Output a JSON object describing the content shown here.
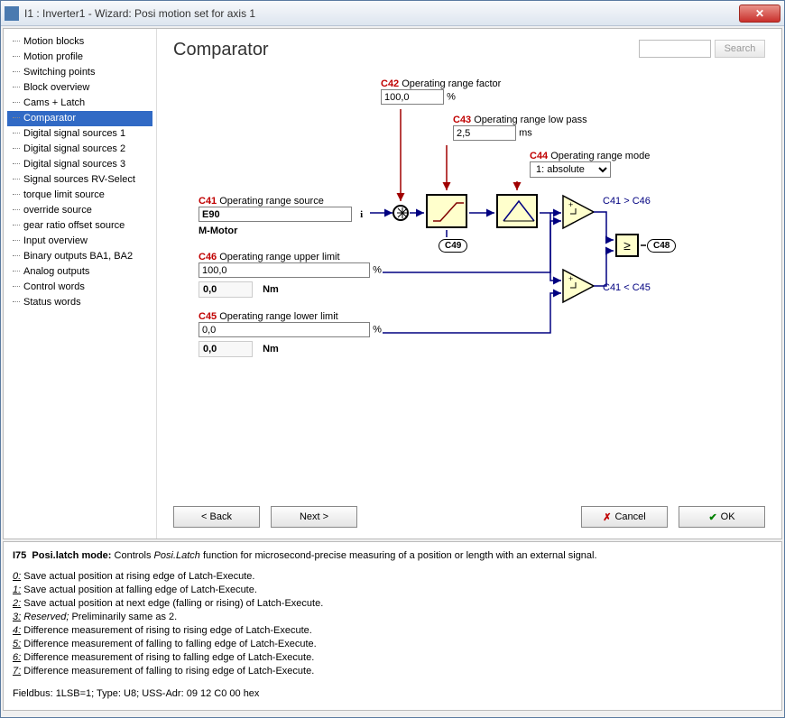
{
  "window": {
    "title": "I1 : Inverter1 - Wizard: Posi motion set for axis 1"
  },
  "sidebar": {
    "items": [
      "Motion blocks",
      "Motion profile",
      "Switching points",
      "Block overview",
      "Cams + Latch",
      "Comparator",
      "Digital signal sources 1",
      "Digital signal sources 2",
      "Digital signal sources 3",
      "Signal sources RV-Select",
      "torque limit source",
      "override source",
      "gear ratio offset source",
      "Input overview",
      "Binary outputs BA1, BA2",
      "Analog outputs",
      "Control words",
      "Status words"
    ],
    "selected_index": 5
  },
  "page": {
    "title": "Comparator",
    "search_placeholder": "",
    "search_btn": "Search"
  },
  "params": {
    "c42": {
      "code": "C42",
      "label": "Operating range factor",
      "value": "100,0",
      "unit": "%"
    },
    "c43": {
      "code": "C43",
      "label": "Operating range low pass",
      "value": "2,5",
      "unit": "ms"
    },
    "c44": {
      "code": "C44",
      "label": "Operating range mode",
      "value": "1: absolute"
    },
    "c41": {
      "code": "C41",
      "label": "Operating range source",
      "value": "E90",
      "info": "i",
      "sub": "M-Motor"
    },
    "c46": {
      "code": "C46",
      "label": "Operating range upper limit",
      "value": "100,0",
      "unit": "%",
      "readout": "0,0",
      "readout_unit": "Nm"
    },
    "c45": {
      "code": "C45",
      "label": "Operating range lower limit",
      "value": "0,0",
      "unit": "%",
      "readout": "0,0",
      "readout_unit": "Nm"
    }
  },
  "blocks": {
    "c49": "C49",
    "c48": "C48",
    "cmp_upper": "C41 > C46",
    "cmp_lower": "C41 < C45",
    "ge": "≥"
  },
  "nav": {
    "back": "< Back",
    "next": "Next >",
    "cancel": "Cancel",
    "ok": "OK"
  },
  "help": {
    "param": "I75",
    "name": "Posi.latch mode:",
    "desc_prefix": "Controls ",
    "desc_em": "Posi.Latch",
    "desc_suffix": " function for microsecond-precise measuring of a position or length with an external signal.",
    "lines": [
      {
        "k": "0:",
        "v": " Save actual position at rising edge of Latch-Execute."
      },
      {
        "k": "1:",
        "v": " Save actual position at falling edge of Latch-Execute."
      },
      {
        "k": "2:",
        "v": " Save actual position at next edge (falling or rising) of Latch-Execute."
      },
      {
        "k": "3:",
        "v": "",
        "em": " Reserved;",
        "v2": " Preliminarily same as 2."
      },
      {
        "k": "4:",
        "v": " Difference measurement of rising to rising edge of Latch-Execute."
      },
      {
        "k": "5:",
        "v": " Difference measurement of falling to falling edge of Latch-Execute."
      },
      {
        "k": "6:",
        "v": " Difference measurement of rising to falling edge of Latch-Execute."
      },
      {
        "k": "7:",
        "v": " Difference measurement of falling to rising edge of Latch-Execute."
      }
    ],
    "footer": "Fieldbus: 1LSB=1; Type: U8; USS-Adr: 09 12 C0 00 hex"
  }
}
